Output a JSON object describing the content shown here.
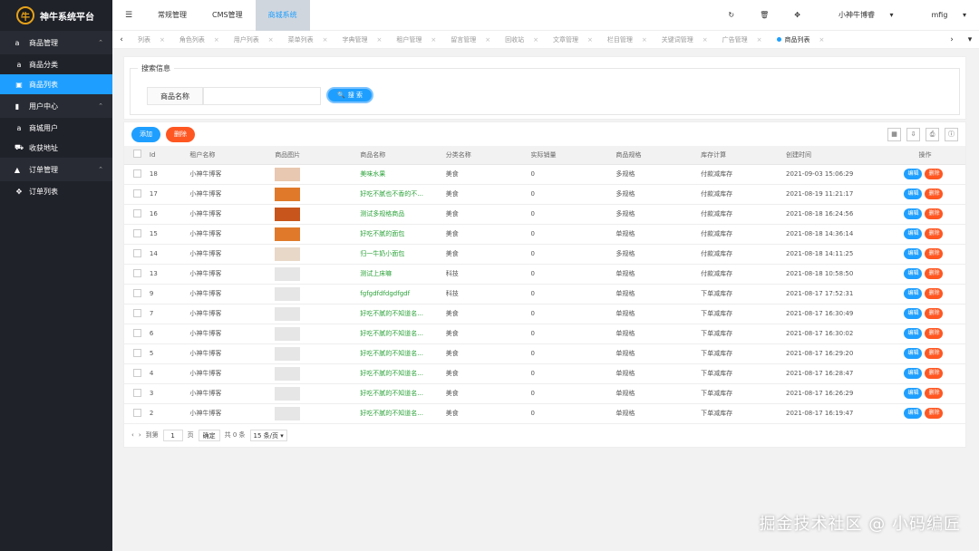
{
  "app": {
    "title": "神牛系统平台",
    "logo_glyph": "牛"
  },
  "sidebar": {
    "groups": [
      {
        "label": "商品管理",
        "icon": "a",
        "items": [
          {
            "label": "商品分类",
            "icon": "a",
            "active": false
          },
          {
            "label": "商品列表",
            "icon": "▣",
            "active": true
          }
        ]
      },
      {
        "label": "用户中心",
        "icon": "▮",
        "items": [
          {
            "label": "商城用户",
            "icon": "a",
            "active": false
          },
          {
            "label": "收获地址",
            "icon": "⛟",
            "active": false
          }
        ]
      },
      {
        "label": "订单管理",
        "icon": "▲",
        "items": [
          {
            "label": "订单列表",
            "icon": "✥",
            "active": false
          }
        ]
      }
    ]
  },
  "topnav": {
    "items": [
      "常规管理",
      "CMS管理",
      "商城系统"
    ],
    "active": "商城系统",
    "icons": {
      "menu": "☰",
      "refresh": "↻",
      "trash": "🗑",
      "fullscreen": "✥"
    },
    "user": "小神牛博睿",
    "lang": "mfig"
  },
  "tabs": [
    "列表",
    "角色列表",
    "用户列表",
    "菜单列表",
    "字典管理",
    "租户管理",
    "留言管理",
    "回收站",
    "文章管理",
    "栏目管理",
    "关键词管理",
    "广告管理",
    "商品列表"
  ],
  "current_tab": "商品列表",
  "search": {
    "legend": "搜索信息",
    "label": "商品名称",
    "placeholder": "",
    "button": "搜 索"
  },
  "toolbar": {
    "add": "添加",
    "delete": "删除"
  },
  "table": {
    "headers": [
      "Id",
      "租户名称",
      "商品图片",
      "商品名称",
      "分类名称",
      "实际销量",
      "商品规格",
      "库存计算",
      "创建时间",
      "操作"
    ],
    "edit": "编辑",
    "del": "删除",
    "rows": [
      {
        "id": "18",
        "tenant": "小神牛博客",
        "img": "#e8c8b0",
        "name": "美味水果",
        "cat": "美食",
        "sales": "0",
        "spec": "多规格",
        "stock": "付款减库存",
        "time": "2021-09-03 15:06:29"
      },
      {
        "id": "17",
        "tenant": "小神牛博客",
        "img": "#e07a2a",
        "name": "好吃不腻也不香的不...",
        "cat": "美食",
        "sales": "0",
        "spec": "多规格",
        "stock": "付款减库存",
        "time": "2021-08-19 11:21:17"
      },
      {
        "id": "16",
        "tenant": "小神牛博客",
        "img": "#c8561c",
        "name": "测试多规格商品",
        "cat": "美食",
        "sales": "0",
        "spec": "多规格",
        "stock": "付款减库存",
        "time": "2021-08-18 16:24:56"
      },
      {
        "id": "15",
        "tenant": "小神牛博客",
        "img": "#e07a2a",
        "name": "好吃不腻的面包",
        "cat": "美食",
        "sales": "0",
        "spec": "单规格",
        "stock": "付款减库存",
        "time": "2021-08-18 14:36:14"
      },
      {
        "id": "14",
        "tenant": "小神牛博客",
        "img": "#e8d8c8",
        "name": "归一牛奶小面包",
        "cat": "美食",
        "sales": "0",
        "spec": "多规格",
        "stock": "付款减库存",
        "time": "2021-08-18 14:11:25"
      },
      {
        "id": "13",
        "tenant": "小神牛博客",
        "img": "#e6e6e6",
        "name": "测试上床嘛",
        "cat": "科技",
        "sales": "0",
        "spec": "单规格",
        "stock": "付款减库存",
        "time": "2021-08-18 10:58:50"
      },
      {
        "id": "9",
        "tenant": "小神牛博客",
        "img": "#e6e6e6",
        "name": "fgfgdfdfdgdfgdf",
        "cat": "科技",
        "sales": "0",
        "spec": "单规格",
        "stock": "下单减库存",
        "time": "2021-08-17 17:52:31"
      },
      {
        "id": "7",
        "tenant": "小神牛博客",
        "img": "#e6e6e6",
        "name": "好吃不腻的不知道名...",
        "cat": "美食",
        "sales": "0",
        "spec": "单规格",
        "stock": "下单减库存",
        "time": "2021-08-17 16:30:49"
      },
      {
        "id": "6",
        "tenant": "小神牛博客",
        "img": "#e6e6e6",
        "name": "好吃不腻的不知道名...",
        "cat": "美食",
        "sales": "0",
        "spec": "单规格",
        "stock": "下单减库存",
        "time": "2021-08-17 16:30:02"
      },
      {
        "id": "5",
        "tenant": "小神牛博客",
        "img": "#e6e6e6",
        "name": "好吃不腻的不知道名...",
        "cat": "美食",
        "sales": "0",
        "spec": "单规格",
        "stock": "下单减库存",
        "time": "2021-08-17 16:29:20"
      },
      {
        "id": "4",
        "tenant": "小神牛博客",
        "img": "#e6e6e6",
        "name": "好吃不腻的不知道名...",
        "cat": "美食",
        "sales": "0",
        "spec": "单规格",
        "stock": "下单减库存",
        "time": "2021-08-17 16:28:47"
      },
      {
        "id": "3",
        "tenant": "小神牛博客",
        "img": "#e6e6e6",
        "name": "好吃不腻的不知道名...",
        "cat": "美食",
        "sales": "0",
        "spec": "单规格",
        "stock": "下单减库存",
        "time": "2021-08-17 16:26:29"
      },
      {
        "id": "2",
        "tenant": "小神牛博客",
        "img": "#e6e6e6",
        "name": "好吃不腻的不知道名...",
        "cat": "美食",
        "sales": "0",
        "spec": "单规格",
        "stock": "下单减库存",
        "time": "2021-08-17 16:19:47"
      }
    ]
  },
  "pager": {
    "goto": "到第",
    "page": "1",
    "page_unit": "页",
    "confirm": "确定",
    "total": "共 0 条",
    "size": "15 条/页"
  },
  "watermark": "掘金技术社区 @ 小码编匠"
}
